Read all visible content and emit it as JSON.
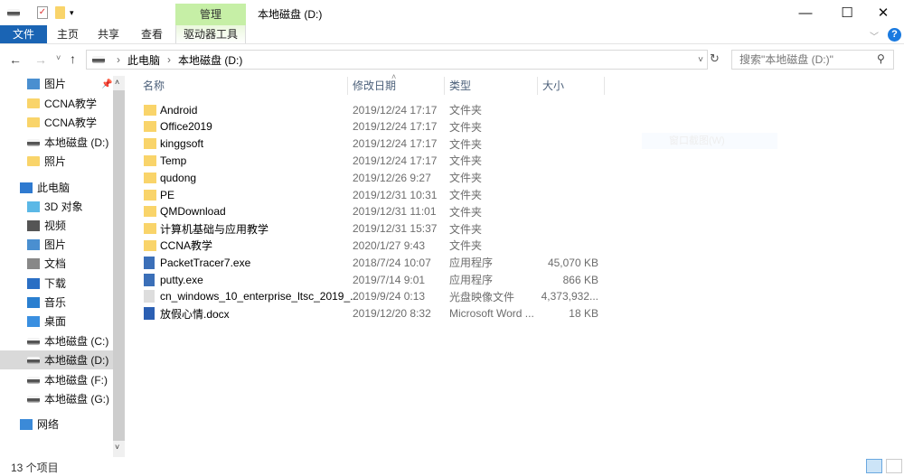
{
  "window": {
    "title": "本地磁盘 (D:)",
    "minimize": "—",
    "maximize": "☐",
    "close": "✕"
  },
  "ribbon": {
    "context_group": "管理",
    "context_tab": "驱动器工具",
    "tabs": [
      "文件",
      "主页",
      "共享",
      "查看"
    ],
    "help": "?"
  },
  "address": {
    "crumbs": [
      "此电脑",
      "本地磁盘 (D:)"
    ],
    "search_placeholder": "搜索\"本地磁盘 (D:)\""
  },
  "nav": {
    "items": [
      {
        "label": "图片",
        "icon": "pictures",
        "pinned": true
      },
      {
        "label": "CCNA教学",
        "icon": "folder"
      },
      {
        "label": "CCNA教学",
        "icon": "folder"
      },
      {
        "label": "本地磁盘 (D:)",
        "icon": "drive"
      },
      {
        "label": "照片",
        "icon": "folder"
      },
      {
        "label": "此电脑",
        "icon": "computer"
      },
      {
        "label": "3D 对象",
        "icon": "3d"
      },
      {
        "label": "视频",
        "icon": "video"
      },
      {
        "label": "图片",
        "icon": "pictures"
      },
      {
        "label": "文档",
        "icon": "documents"
      },
      {
        "label": "下载",
        "icon": "download"
      },
      {
        "label": "音乐",
        "icon": "music"
      },
      {
        "label": "桌面",
        "icon": "desktop"
      },
      {
        "label": "本地磁盘 (C:)",
        "icon": "drive"
      },
      {
        "label": "本地磁盘 (D:)",
        "icon": "drive",
        "selected": true
      },
      {
        "label": "本地磁盘 (F:)",
        "icon": "drive"
      },
      {
        "label": "本地磁盘 (G:)",
        "icon": "drive"
      },
      {
        "label": "网络",
        "icon": "network"
      }
    ]
  },
  "columns": {
    "name": "名称",
    "date": "修改日期",
    "type": "类型",
    "size": "大小"
  },
  "files": [
    {
      "name": "Android",
      "date": "2019/12/24 17:17",
      "type": "文件夹",
      "size": "",
      "icon": "folder"
    },
    {
      "name": "Office2019",
      "date": "2019/12/24 17:17",
      "type": "文件夹",
      "size": "",
      "icon": "folder"
    },
    {
      "name": "kinggsoft",
      "date": "2019/12/24 17:17",
      "type": "文件夹",
      "size": "",
      "icon": "folder"
    },
    {
      "name": "Temp",
      "date": "2019/12/24 17:17",
      "type": "文件夹",
      "size": "",
      "icon": "folder"
    },
    {
      "name": "qudong",
      "date": "2019/12/26 9:27",
      "type": "文件夹",
      "size": "",
      "icon": "folder"
    },
    {
      "name": "PE",
      "date": "2019/12/31 10:31",
      "type": "文件夹",
      "size": "",
      "icon": "folder"
    },
    {
      "name": "QMDownload",
      "date": "2019/12/31 11:01",
      "type": "文件夹",
      "size": "",
      "icon": "folder"
    },
    {
      "name": "计算机基础与应用教学",
      "date": "2019/12/31 15:37",
      "type": "文件夹",
      "size": "",
      "icon": "folder"
    },
    {
      "name": "CCNA教学",
      "date": "2020/1/27 9:43",
      "type": "文件夹",
      "size": "",
      "icon": "folder"
    },
    {
      "name": "PacketTracer7.exe",
      "date": "2018/7/24 10:07",
      "type": "应用程序",
      "size": "45,070 KB",
      "icon": "exe"
    },
    {
      "name": "putty.exe",
      "date": "2019/7/14 9:01",
      "type": "应用程序",
      "size": "866 KB",
      "icon": "exe"
    },
    {
      "name": "cn_windows_10_enterprise_ltsc_2019_...",
      "date": "2019/9/24 0:13",
      "type": "光盘映像文件",
      "size": "4,373,932...",
      "icon": "iso"
    },
    {
      "name": "放假心情.docx",
      "date": "2019/12/20 8:32",
      "type": "Microsoft Word ...",
      "size": "18 KB",
      "icon": "word"
    }
  ],
  "ghost_tooltip": "窗口截图(W)",
  "status": {
    "count": "13 个项目"
  },
  "colors": {
    "file_tab": "#1a64b4",
    "context": "#c6efa6",
    "selected": "#d9d9d9"
  }
}
